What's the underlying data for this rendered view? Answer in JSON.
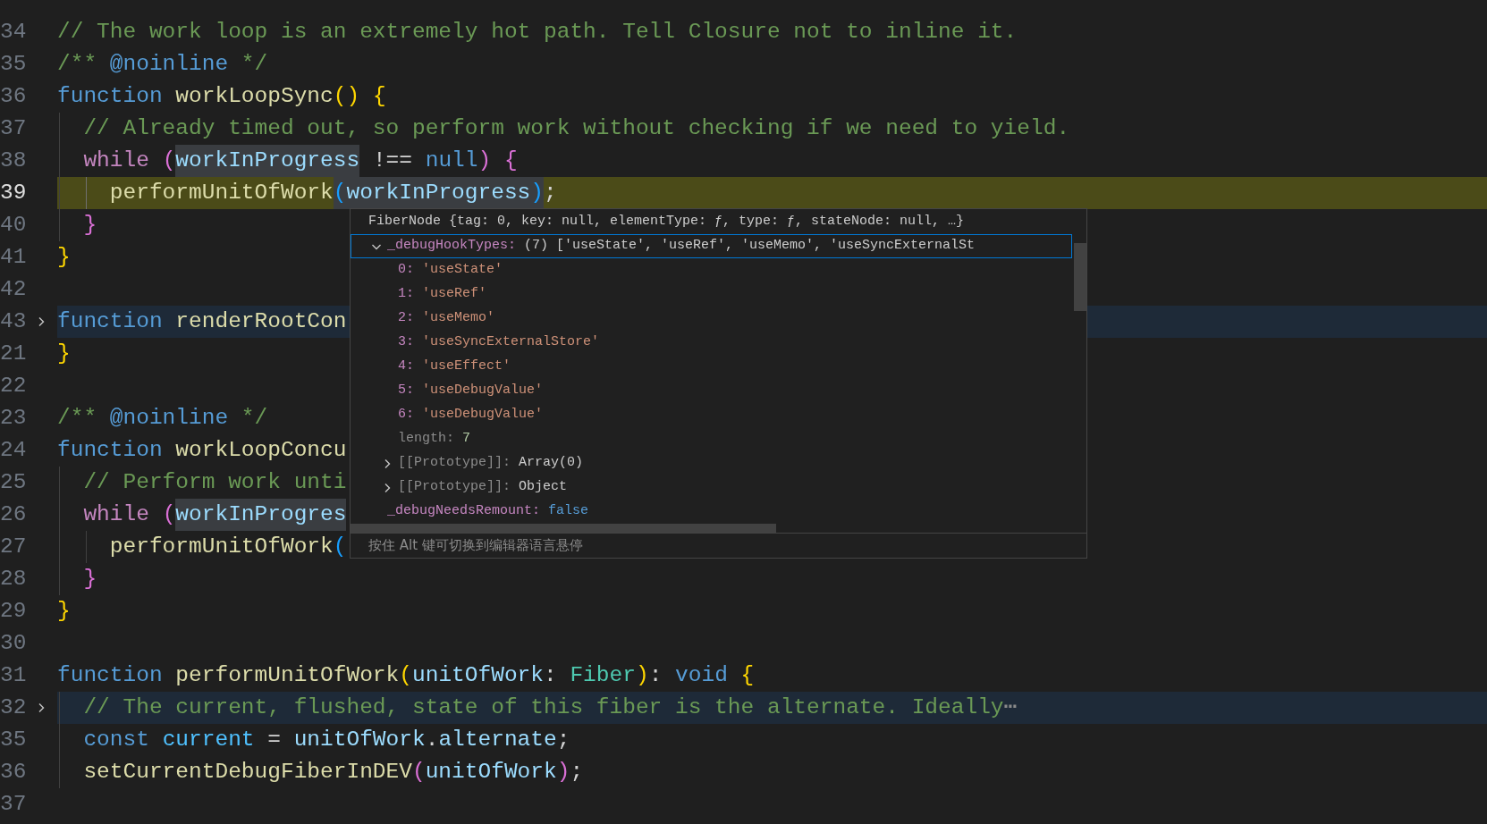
{
  "editor": {
    "lines": [
      {
        "number": "34",
        "current": false,
        "folded": false,
        "tokens": [
          {
            "text": "// The work loop is an extremely hot path. Tell Closure not to inline it.",
            "kind": "comment"
          }
        ]
      },
      {
        "number": "35",
        "current": false,
        "folded": false,
        "tokens": [
          {
            "text": "/** ",
            "kind": "comment"
          },
          {
            "text": "@noinline",
            "kind": "keyword"
          },
          {
            "text": " */",
            "kind": "comment"
          }
        ]
      },
      {
        "number": "36",
        "current": false,
        "folded": false,
        "tokens": [
          {
            "text": "function",
            "kind": "keyword"
          },
          {
            "text": " workLoopSync",
            "kind": "function"
          },
          {
            "text": "()",
            "kind": "bracket1"
          },
          {
            "text": " {",
            "kind": "bracket1"
          }
        ]
      },
      {
        "number": "37",
        "current": false,
        "folded": false,
        "tokens": [
          {
            "text": "  // Already timed out, so perform work without checking if we need to yield.",
            "kind": "comment"
          }
        ]
      },
      {
        "number": "38",
        "current": false,
        "folded": false,
        "tokens": [
          {
            "text": "  while",
            "kind": "control"
          },
          {
            "text": " (",
            "kind": "bracket2"
          },
          {
            "text": "workInProgress",
            "kind": "variable",
            "match": true
          },
          {
            "text": " !==",
            "kind": "plain"
          },
          {
            "text": " null",
            "kind": "keyword"
          },
          {
            "text": ")",
            "kind": "bracket2"
          },
          {
            "text": " {",
            "kind": "bracket2"
          }
        ]
      },
      {
        "number": "39",
        "current": true,
        "folded": false,
        "tokens": [
          {
            "text": "    performUnitOfWork",
            "kind": "function"
          },
          {
            "text": "(",
            "kind": "bracket3",
            "match": true
          },
          {
            "text": "workInProgress",
            "kind": "variable",
            "match": true
          },
          {
            "text": ")",
            "kind": "bracket3",
            "match": true
          },
          {
            "text": ";",
            "kind": "plain"
          }
        ]
      },
      {
        "number": "40",
        "current": false,
        "folded": false,
        "tokens": [
          {
            "text": "  }",
            "kind": "bracket2"
          }
        ]
      },
      {
        "number": "41",
        "current": false,
        "folded": false,
        "tokens": [
          {
            "text": "}",
            "kind": "bracket1"
          }
        ]
      },
      {
        "number": "42",
        "current": false,
        "folded": false
      },
      {
        "number": "43",
        "current": false,
        "folded": true,
        "tokens": [
          {
            "text": "function",
            "kind": "keyword"
          },
          {
            "text": " renderRootCon",
            "kind": "function"
          }
        ]
      },
      {
        "number": "21",
        "current": false,
        "folded": false,
        "tokens": [
          {
            "text": "}",
            "kind": "bracket1"
          }
        ]
      },
      {
        "number": "22",
        "current": false,
        "folded": false
      },
      {
        "number": "23",
        "current": false,
        "folded": false,
        "tokens": [
          {
            "text": "/** ",
            "kind": "comment"
          },
          {
            "text": "@noinline",
            "kind": "keyword"
          },
          {
            "text": " */",
            "kind": "comment"
          }
        ]
      },
      {
        "number": "24",
        "current": false,
        "folded": false,
        "tokens": [
          {
            "text": "function",
            "kind": "keyword"
          },
          {
            "text": " workLoopConcu",
            "kind": "function"
          }
        ]
      },
      {
        "number": "25",
        "current": false,
        "folded": false,
        "tokens": [
          {
            "text": "  // Perform work unti",
            "kind": "comment"
          }
        ]
      },
      {
        "number": "26",
        "current": false,
        "folded": false,
        "tokens": [
          {
            "text": "  while",
            "kind": "control"
          },
          {
            "text": " (",
            "kind": "bracket2"
          },
          {
            "text": "workInProgres",
            "kind": "variable",
            "match": true
          }
        ]
      },
      {
        "number": "27",
        "current": false,
        "folded": false,
        "tokens": [
          {
            "text": "    performUnitOfWork",
            "kind": "function"
          },
          {
            "text": "(",
            "kind": "bracket3"
          }
        ]
      },
      {
        "number": "28",
        "current": false,
        "folded": false,
        "tokens": [
          {
            "text": "  }",
            "kind": "bracket2"
          }
        ]
      },
      {
        "number": "29",
        "current": false,
        "folded": false,
        "tokens": [
          {
            "text": "}",
            "kind": "bracket1"
          }
        ]
      },
      {
        "number": "30",
        "current": false,
        "folded": false
      },
      {
        "number": "31",
        "current": false,
        "folded": false,
        "tokens": [
          {
            "text": "function",
            "kind": "keyword"
          },
          {
            "text": " performUnitOfWork",
            "kind": "function"
          },
          {
            "text": "(",
            "kind": "bracket1"
          },
          {
            "text": "unitOfWork",
            "kind": "variable"
          },
          {
            "text": ":",
            "kind": "plain"
          },
          {
            "text": " Fiber",
            "kind": "type"
          },
          {
            "text": ")",
            "kind": "bracket1"
          },
          {
            "text": ":",
            "kind": "plain"
          },
          {
            "text": " void",
            "kind": "keyword"
          },
          {
            "text": " {",
            "kind": "bracket1"
          }
        ]
      },
      {
        "number": "32",
        "current": false,
        "folded": true,
        "tokens": [
          {
            "text": "  // The current, flushed, state of this fiber is the alternate. Ideally",
            "kind": "comment"
          },
          {
            "text": "⋯",
            "kind": "ellipsis"
          }
        ]
      },
      {
        "number": "35",
        "current": false,
        "folded": false,
        "tokens": [
          {
            "text": "  const",
            "kind": "keyword"
          },
          {
            "text": " current",
            "kind": "constant"
          },
          {
            "text": " =",
            "kind": "plain"
          },
          {
            "text": " unitOfWork",
            "kind": "variable"
          },
          {
            "text": ".",
            "kind": "plain"
          },
          {
            "text": "alternate",
            "kind": "variable"
          },
          {
            "text": ";",
            "kind": "plain"
          }
        ]
      },
      {
        "number": "36",
        "current": false,
        "folded": false,
        "tokens": [
          {
            "text": "  setCurrentDebugFiberInDEV",
            "kind": "function"
          },
          {
            "text": "(",
            "kind": "bracket2"
          },
          {
            "text": "unitOfWork",
            "kind": "variable"
          },
          {
            "text": ")",
            "kind": "bracket2"
          },
          {
            "text": ";",
            "kind": "plain"
          }
        ]
      },
      {
        "number": "37",
        "current": false,
        "folded": false
      }
    ]
  },
  "hover": {
    "header": "FiberNode {tag: 0, key: null, elementType: ƒ, type: ƒ, stateNode: null, …}",
    "entries": [
      {
        "key": "_debugHookTypes:",
        "value": "(7) ['useState', 'useRef', 'useMemo', 'useSyncExternalSt",
        "kind": "object",
        "dim": false,
        "expanded": true,
        "focused": true,
        "children": [
          {
            "key": "0:",
            "value": "'useState'",
            "kind": "string",
            "dim": false,
            "focused": false
          },
          {
            "key": "1:",
            "value": "'useRef'",
            "kind": "string",
            "dim": false,
            "focused": false
          },
          {
            "key": "2:",
            "value": "'useMemo'",
            "kind": "string",
            "dim": false,
            "focused": false
          },
          {
            "key": "3:",
            "value": "'useSyncExternalStore'",
            "kind": "string",
            "dim": false,
            "focused": false
          },
          {
            "key": "4:",
            "value": "'useEffect'",
            "kind": "string",
            "dim": false,
            "focused": false
          },
          {
            "key": "5:",
            "value": "'useDebugValue'",
            "kind": "string",
            "dim": false,
            "focused": false
          },
          {
            "key": "6:",
            "value": "'useDebugValue'",
            "kind": "string",
            "dim": false,
            "focused": false
          },
          {
            "key": "length:",
            "value": "7",
            "kind": "number",
            "dim": true,
            "focused": false
          },
          {
            "key": "[[Prototype]]:",
            "value": "Array(0)",
            "kind": "object",
            "dim": true,
            "expanded": false,
            "focused": false
          },
          {
            "key": "[[Prototype]]:",
            "value": "Object",
            "kind": "object",
            "dim": true,
            "expanded": false,
            "focused": false
          }
        ]
      },
      {
        "key": "_debugNeedsRemount:",
        "value": "false",
        "kind": "boolean",
        "dim": false,
        "focused": false
      }
    ],
    "footer": "按住 Alt 键可切换到编辑器语言悬停"
  }
}
